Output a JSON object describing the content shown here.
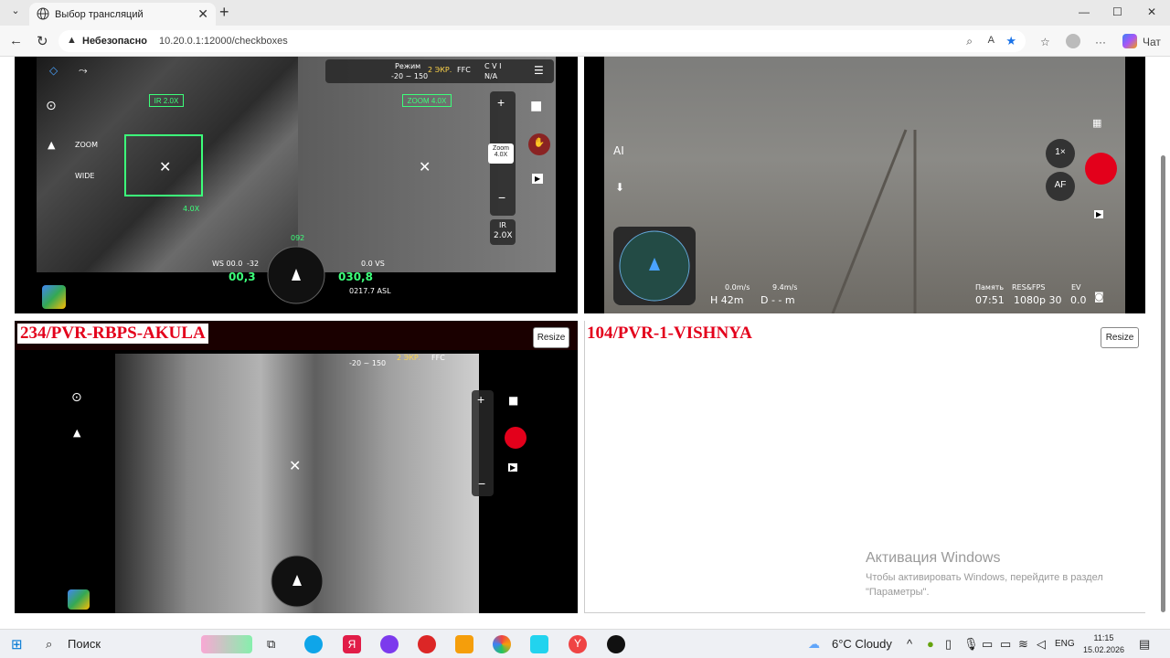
{
  "browser": {
    "tab_title": "Выбор трансляций",
    "url_warning": "Небезопасно",
    "url": "10.20.0.1:12000/checkboxes",
    "chat_label": "Чат"
  },
  "feeds": {
    "top_left": {
      "ir_zoom": "IR 2.0X",
      "zoom_box": "ZOOM 4.0X",
      "zoom_label": "ZOOM",
      "wide_label": "WIDE",
      "bracket_zoom": "4.0X",
      "mode_label": "Режим",
      "mode_range": "-20 ~ 150",
      "ekr": "2 ЭКР.",
      "ffc": "FFC",
      "cvi": "C V I",
      "na": "N/A",
      "zoom_pill_label": "Zoom",
      "zoom_pill_value": "4.0X",
      "ir_label": "IR",
      "ir_value": "2.0X",
      "ws": "WS 00.0",
      "ws_dir": "-32",
      "speed": "00,3",
      "heading": "030,8",
      "vs": "0.0 VS",
      "asl": "0217.7 ASL",
      "compass": "092"
    },
    "top_right": {
      "zoom_1x": "1×",
      "af": "AF",
      "speed_h": "0.0m/s",
      "speed_v": "9.4m/s",
      "height": "H 42m",
      "distance": "D - - m",
      "memory": "Память",
      "res": "RES&FPS",
      "ev": "EV",
      "time": "07:51",
      "resolution": "1080p 30",
      "ev_value": "0.0"
    },
    "bottom_left": {
      "title": "234/PVR-RBPS-AKULA",
      "resize": "Resize",
      "ekr": "2 ЭКР.",
      "ffc": "FFC",
      "range": "-20 ~ 150"
    },
    "bottom_right": {
      "title": "104/PVR-1-VISHNYA",
      "resize": "Resize"
    }
  },
  "watermark": {
    "title": "Активация Windows",
    "subtitle": "Чтобы активировать Windows, перейдите в раздел \"Параметры\"."
  },
  "taskbar": {
    "search": "Поиск",
    "weather": "6°C  Cloudy",
    "lang": "ENG",
    "time": "11:15",
    "date": "15.02.2026"
  }
}
